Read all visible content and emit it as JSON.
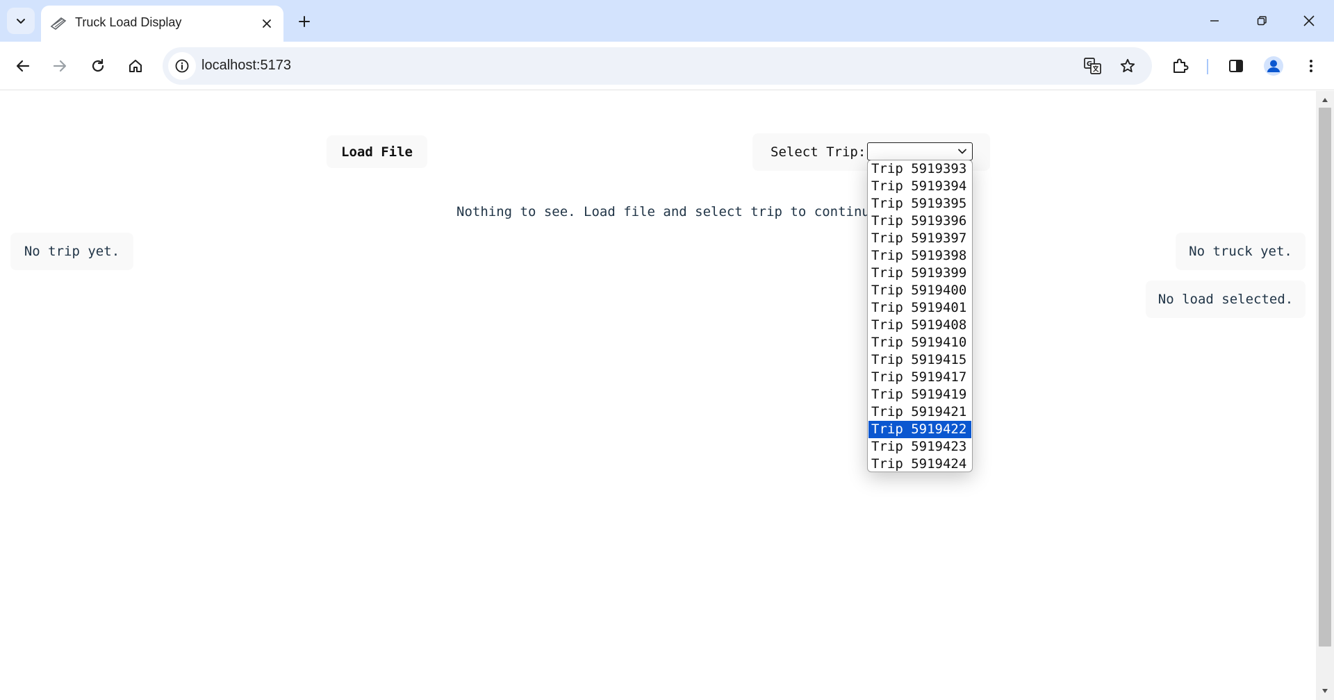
{
  "browser": {
    "tab_title": "Truck Load Display",
    "url": "localhost:5173"
  },
  "page": {
    "load_button_label": "Load File",
    "select_trip_label": "Select Trip:",
    "selected_trip_value": "",
    "empty_message": "Nothing to see. Load file and select trip to continue.",
    "trip_panel_text": "No trip yet.",
    "truck_panel_text": "No truck yet.",
    "load_panel_text": "No load selected."
  },
  "dropdown": {
    "highlighted": "Trip 5919422",
    "options": [
      "Trip 5919393",
      "Trip 5919394",
      "Trip 5919395",
      "Trip 5919396",
      "Trip 5919397",
      "Trip 5919398",
      "Trip 5919399",
      "Trip 5919400",
      "Trip 5919401",
      "Trip 5919408",
      "Trip 5919410",
      "Trip 5919415",
      "Trip 5919417",
      "Trip 5919419",
      "Trip 5919421",
      "Trip 5919422",
      "Trip 5919423",
      "Trip 5919424"
    ]
  },
  "colors": {
    "tabstrip_bg": "#d3e3fd",
    "highlight": "#0b57d0",
    "panel_bg": "#f9f9f9"
  }
}
